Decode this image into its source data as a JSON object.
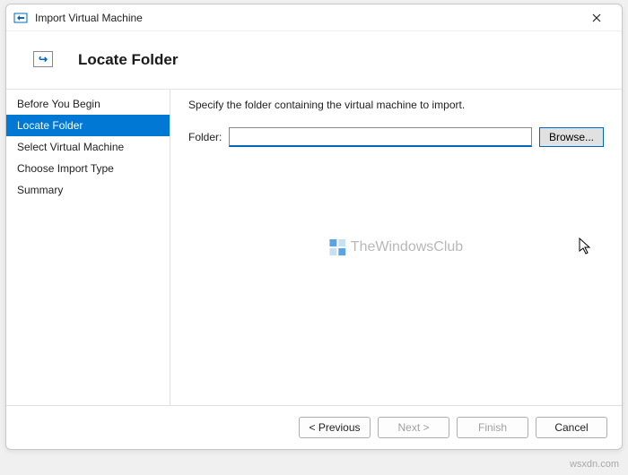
{
  "window": {
    "title": "Import Virtual Machine"
  },
  "header": {
    "heading": "Locate Folder"
  },
  "sidebar": {
    "steps": [
      "Before You Begin",
      "Locate Folder",
      "Select Virtual Machine",
      "Choose Import Type",
      "Summary"
    ],
    "activeIndex": 1
  },
  "content": {
    "instruction": "Specify the folder containing the virtual machine to import.",
    "folderLabel": "Folder:",
    "folderValue": "",
    "browseLabel": "Browse..."
  },
  "watermark": {
    "text": "TheWindowsClub"
  },
  "footer": {
    "previous": "< Previous",
    "next": "Next >",
    "finish": "Finish",
    "cancel": "Cancel"
  },
  "attribution": "wsxdn.com"
}
